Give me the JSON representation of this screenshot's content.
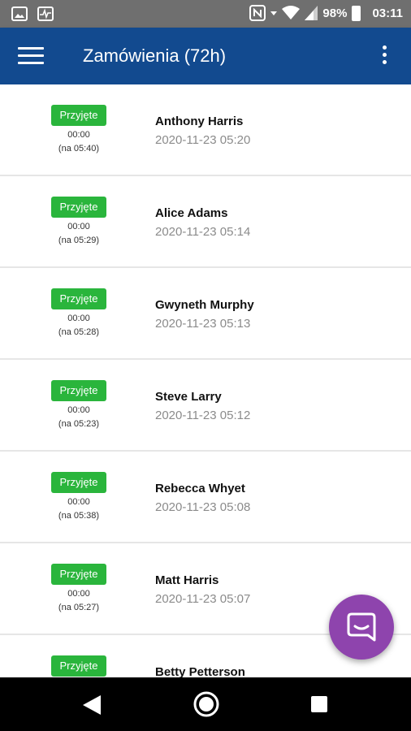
{
  "statusbar": {
    "battery": "98%",
    "time": "03:11",
    "icons": [
      "image-icon",
      "pulse-icon",
      "nfc-icon",
      "wifi-icon",
      "signal-icon",
      "battery-icon"
    ]
  },
  "appbar": {
    "title": "Zamówienia (72h)",
    "background": "#124a8f"
  },
  "orders": [
    {
      "status": "Przyjęte",
      "timer": "00:00",
      "deadline": "(na 05:40)",
      "customer": "Anthony Harris",
      "datetime": "2020-11-23 05:20"
    },
    {
      "status": "Przyjęte",
      "timer": "00:00",
      "deadline": "(na 05:29)",
      "customer": "Alice Adams",
      "datetime": "2020-11-23 05:14"
    },
    {
      "status": "Przyjęte",
      "timer": "00:00",
      "deadline": "(na 05:28)",
      "customer": "Gwyneth Murphy",
      "datetime": "2020-11-23 05:13"
    },
    {
      "status": "Przyjęte",
      "timer": "00:00",
      "deadline": "(na 05:23)",
      "customer": "Steve Larry",
      "datetime": "2020-11-23 05:12"
    },
    {
      "status": "Przyjęte",
      "timer": "00:00",
      "deadline": "(na 05:38)",
      "customer": "Rebecca Whyet",
      "datetime": "2020-11-23 05:08"
    },
    {
      "status": "Przyjęte",
      "timer": "00:00",
      "deadline": "(na 05:27)",
      "customer": "Matt Harris",
      "datetime": "2020-11-23 05:07"
    },
    {
      "status": "Przyjęte",
      "timer": "",
      "deadline": "",
      "customer": "Betty Petterson",
      "datetime": ""
    }
  ],
  "colors": {
    "status_green": "#2ab53c",
    "chat_purple": "#8e44ad"
  }
}
